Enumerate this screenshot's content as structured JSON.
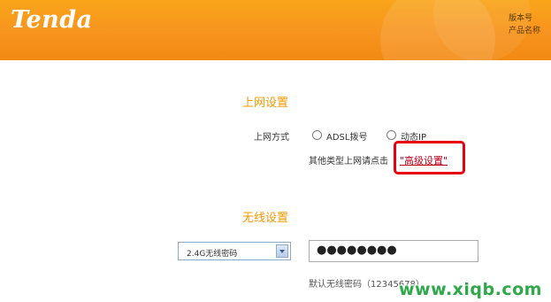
{
  "header": {
    "logo_text": "Tenda",
    "info_line1": "版本号",
    "info_line2": "产品名称",
    "brand_color": "#f7931e"
  },
  "internet": {
    "section_title": "上网设置",
    "mode_label": "上网方式",
    "options": [
      {
        "label": "ADSL拨号",
        "selected": false
      },
      {
        "label": "动态IP",
        "selected": false
      }
    ],
    "other_type_text": "其他类型上网请点击",
    "advanced_link": "\"高级设置\"",
    "highlight_color": "#e60012"
  },
  "wireless": {
    "section_title": "无线设置",
    "select_value": "2.4G无线密码",
    "password_value": "●●●●●●●●",
    "default_hint": "默认无线密码（12345678）"
  },
  "watermark": "www.xiqb.com"
}
